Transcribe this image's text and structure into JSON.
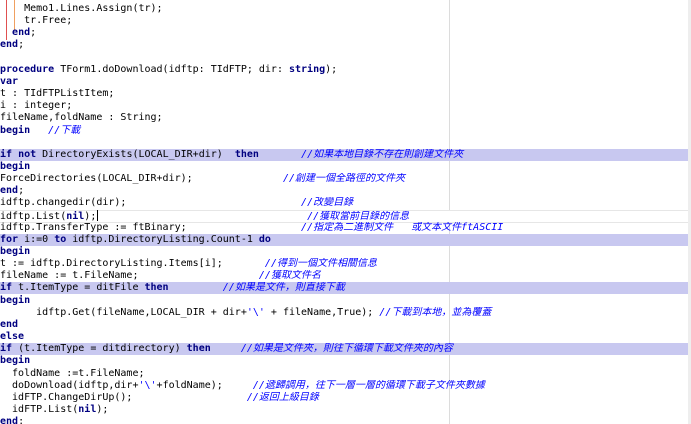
{
  "editor": {
    "colors": {
      "highlight_line": "#c8c8f0",
      "keyword": "#000080",
      "comment": "#0000ff",
      "string": "#0000ff",
      "structure_line": "#e05050"
    },
    "lines": [
      {
        "hl": false,
        "segs": [
          {
            "t": "    Memo1.Lines.Assign(tr);",
            "c": "tx"
          }
        ]
      },
      {
        "hl": false,
        "segs": [
          {
            "t": "    tr.Free;",
            "c": "tx"
          }
        ]
      },
      {
        "hl": false,
        "segs": [
          {
            "t": "  ",
            "c": "tx"
          },
          {
            "t": "end",
            "c": "kw"
          },
          {
            "t": ";",
            "c": "tx"
          }
        ]
      },
      {
        "hl": false,
        "segs": [
          {
            "t": "end",
            "c": "kw"
          },
          {
            "t": ";",
            "c": "tx"
          }
        ]
      },
      {
        "hl": false,
        "segs": []
      },
      {
        "hl": false,
        "segs": [
          {
            "t": "procedure",
            "c": "kw"
          },
          {
            "t": " TForm1.doDownload(idftp: TIdFTP; dir: ",
            "c": "tx"
          },
          {
            "t": "string",
            "c": "kw"
          },
          {
            "t": ");",
            "c": "tx"
          }
        ]
      },
      {
        "hl": false,
        "segs": [
          {
            "t": "var",
            "c": "kw"
          }
        ]
      },
      {
        "hl": false,
        "segs": [
          {
            "t": "t : TIdFTPListItem;",
            "c": "tx"
          }
        ]
      },
      {
        "hl": false,
        "segs": [
          {
            "t": "i : integer;",
            "c": "tx"
          }
        ]
      },
      {
        "hl": false,
        "segs": [
          {
            "t": "fileName,foldName : String;",
            "c": "tx"
          }
        ]
      },
      {
        "hl": false,
        "segs": [
          {
            "t": "begin",
            "c": "kw"
          },
          {
            "t": "   ",
            "c": "tx"
          },
          {
            "t": "//下載",
            "c": "cm"
          }
        ]
      },
      {
        "hl": false,
        "segs": []
      },
      {
        "hl": true,
        "segs": [
          {
            "t": "if",
            "c": "kw"
          },
          {
            "t": " ",
            "c": "tx"
          },
          {
            "t": "not",
            "c": "kw"
          },
          {
            "t": " DirectoryExists(LOCAL_DIR+dir)  ",
            "c": "tx"
          },
          {
            "t": "then",
            "c": "kw"
          },
          {
            "t": "       ",
            "c": "tx"
          },
          {
            "t": "//如果本地目錄不存在則創建文件夾",
            "c": "cm"
          }
        ]
      },
      {
        "hl": false,
        "segs": [
          {
            "t": "begin",
            "c": "kw"
          }
        ]
      },
      {
        "hl": false,
        "segs": [
          {
            "t": "ForceDirectories(LOCAL_DIR+dir);",
            "c": "tx"
          },
          {
            "t": "               ",
            "c": "tx"
          },
          {
            "t": "//創建一個全路徑的文件夾",
            "c": "cm"
          }
        ]
      },
      {
        "hl": false,
        "segs": [
          {
            "t": "end",
            "c": "kw"
          },
          {
            "t": ";",
            "c": "tx"
          }
        ]
      },
      {
        "hl": false,
        "segs": [
          {
            "t": "idftp.changedir(dir);",
            "c": "tx"
          },
          {
            "t": "                             ",
            "c": "tx"
          },
          {
            "t": "//改變目錄",
            "c": "cm"
          }
        ]
      },
      {
        "hl": false,
        "cur": true,
        "segs": [
          {
            "t": "idftp.List(",
            "c": "tx"
          },
          {
            "t": "nil",
            "c": "kw"
          },
          {
            "t": "); ",
            "c": "tx"
          },
          {
            "t": "                                  ",
            "c": "tx"
          },
          {
            "t": "//獲取當前目錄的信息",
            "c": "cm"
          }
        ]
      },
      {
        "hl": false,
        "segs": [
          {
            "t": "idftp.TransferType := ftBinary;",
            "c": "tx"
          },
          {
            "t": "                   ",
            "c": "tx"
          },
          {
            "t": "//指定為二進制文件   或文本文件ftASCII",
            "c": "cm"
          }
        ]
      },
      {
        "hl": true,
        "segs": [
          {
            "t": "for",
            "c": "kw"
          },
          {
            "t": " i:=0 ",
            "c": "tx"
          },
          {
            "t": "to",
            "c": "kw"
          },
          {
            "t": " idftp.DirectoryListing.Count-1 ",
            "c": "tx"
          },
          {
            "t": "do",
            "c": "kw"
          }
        ]
      },
      {
        "hl": false,
        "segs": [
          {
            "t": "begin",
            "c": "kw"
          }
        ]
      },
      {
        "hl": false,
        "segs": [
          {
            "t": "t := idftp.DirectoryListing.Items[i];",
            "c": "tx"
          },
          {
            "t": "       ",
            "c": "tx"
          },
          {
            "t": "//得到一個文件相關信息",
            "c": "cm"
          }
        ]
      },
      {
        "hl": false,
        "segs": [
          {
            "t": "fileName := t.FileName;",
            "c": "tx"
          },
          {
            "t": "                    ",
            "c": "tx"
          },
          {
            "t": "//獲取文件名",
            "c": "cm"
          }
        ]
      },
      {
        "hl": true,
        "segs": [
          {
            "t": "if",
            "c": "kw"
          },
          {
            "t": " t.ItemType = ditFile ",
            "c": "tx"
          },
          {
            "t": "then",
            "c": "kw"
          },
          {
            "t": "         ",
            "c": "tx"
          },
          {
            "t": "//如果是文件，則直接下載",
            "c": "cm"
          }
        ]
      },
      {
        "hl": false,
        "segs": [
          {
            "t": "begin",
            "c": "kw"
          }
        ]
      },
      {
        "hl": false,
        "segs": [
          {
            "t": "      idftp.Get(fileName,LOCAL_DIR + dir+",
            "c": "tx"
          },
          {
            "t": "'\\'",
            "c": "st"
          },
          {
            "t": " + fileName,True); ",
            "c": "tx"
          },
          {
            "t": "//下載到本地，並為覆蓋",
            "c": "cm"
          }
        ]
      },
      {
        "hl": false,
        "segs": [
          {
            "t": "end",
            "c": "kw"
          }
        ]
      },
      {
        "hl": false,
        "segs": [
          {
            "t": "else",
            "c": "kw"
          }
        ]
      },
      {
        "hl": true,
        "segs": [
          {
            "t": "if",
            "c": "kw"
          },
          {
            "t": " (t.ItemType = ditdirectory) ",
            "c": "tx"
          },
          {
            "t": "then",
            "c": "kw"
          },
          {
            "t": "     ",
            "c": "tx"
          },
          {
            "t": "//如果是文件夾，則往下循環下載文件夾的內容",
            "c": "cm"
          }
        ]
      },
      {
        "hl": false,
        "segs": [
          {
            "t": "begin",
            "c": "kw"
          }
        ]
      },
      {
        "hl": false,
        "segs": [
          {
            "t": "  foldName :=t.FileName;",
            "c": "tx"
          }
        ]
      },
      {
        "hl": false,
        "segs": [
          {
            "t": "  doDownload(idftp,dir+",
            "c": "tx"
          },
          {
            "t": "'\\'",
            "c": "st"
          },
          {
            "t": "+foldName);     ",
            "c": "tx"
          },
          {
            "t": "//遞歸調用，往下一層一層的循環下載子文件夾數據",
            "c": "cm"
          }
        ]
      },
      {
        "hl": false,
        "segs": [
          {
            "t": "  idFTP.ChangeDirUp();",
            "c": "tx"
          },
          {
            "t": "                   ",
            "c": "tx"
          },
          {
            "t": "//返回上級目錄",
            "c": "cm"
          }
        ]
      },
      {
        "hl": false,
        "segs": [
          {
            "t": "  idFTP.List(",
            "c": "tx"
          },
          {
            "t": "nil",
            "c": "kw"
          },
          {
            "t": ");",
            "c": "tx"
          }
        ]
      },
      {
        "hl": false,
        "segs": [
          {
            "t": "end",
            "c": "kw"
          },
          {
            "t": ";",
            "c": "tx"
          }
        ]
      }
    ]
  }
}
